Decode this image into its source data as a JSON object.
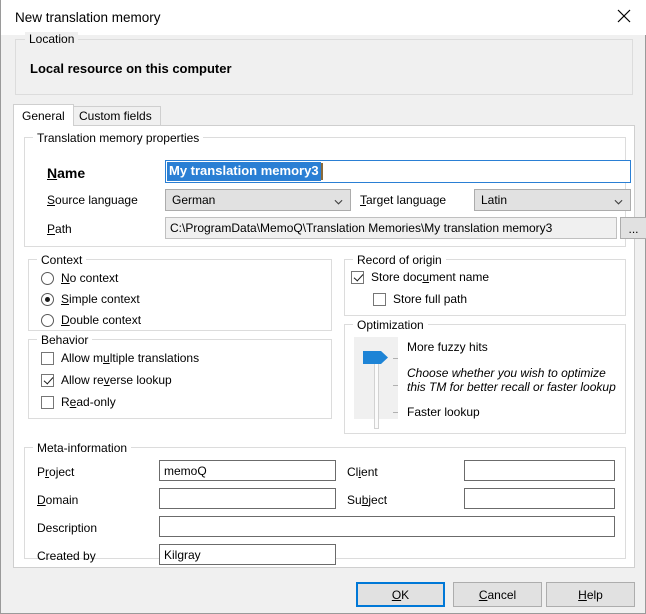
{
  "window": {
    "title": "New translation memory",
    "close_icon": "close-icon"
  },
  "location": {
    "legend": "Location",
    "value": "Local resource on this computer"
  },
  "tabs": [
    {
      "label": "General",
      "active": true
    },
    {
      "label": "Custom fields",
      "active": false
    }
  ],
  "properties": {
    "legend": "Translation memory properties",
    "name_label": "Name",
    "name_value": "My translation memory3",
    "source_language_label": "Source language",
    "source_language_value": "German",
    "target_language_label": "Target language",
    "target_language_value": "Latin",
    "path_label": "Path",
    "path_value": "C:\\ProgramData\\MemoQ\\Translation Memories\\My translation memory3",
    "browse_label": "...",
    "chevron_icon": "chevron-down-icon"
  },
  "context": {
    "legend": "Context",
    "options": [
      {
        "label": "No context",
        "selected": false
      },
      {
        "label": "Simple context",
        "selected": true
      },
      {
        "label": "Double context",
        "selected": false
      }
    ]
  },
  "behavior": {
    "legend": "Behavior",
    "options": [
      {
        "label": "Allow multiple translations",
        "checked": false
      },
      {
        "label": "Allow reverse lookup",
        "checked": true
      },
      {
        "label": "Read-only",
        "checked": false
      }
    ]
  },
  "record_of_origin": {
    "legend": "Record of origin",
    "options": [
      {
        "label": "Store document name",
        "checked": true
      },
      {
        "label": "Store full path",
        "checked": false
      }
    ]
  },
  "optimization": {
    "legend": "Optimization",
    "top_label": "More fuzzy hits",
    "bottom_label": "Faster lookup",
    "description": "Choose whether you wish to optimize this TM for better recall or faster lookup",
    "slider_position": "top",
    "slider_color": "#1e84d6"
  },
  "meta": {
    "legend": "Meta-information",
    "fields": [
      {
        "label": "Project",
        "value": "memoQ"
      },
      {
        "label": "Client",
        "value": ""
      },
      {
        "label": "Domain",
        "value": ""
      },
      {
        "label": "Subject",
        "value": ""
      },
      {
        "label": "Description",
        "value": ""
      },
      {
        "label": "Created by",
        "value": "Kilgray"
      }
    ]
  },
  "footer": {
    "ok_label": "OK",
    "cancel_label": "Cancel",
    "help_label": "Help"
  },
  "colors": {
    "accent": "#0078d7",
    "selection": "#2a7fd4",
    "dialog_bg": "#f0f0f0",
    "panel_bg": "#ffffff"
  }
}
